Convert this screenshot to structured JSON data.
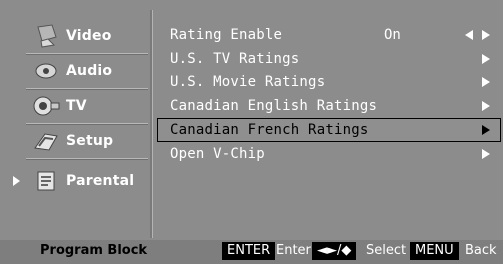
{
  "sidebar": {
    "items": [
      {
        "label": "Video",
        "icon": "video-icon"
      },
      {
        "label": "Audio",
        "icon": "audio-icon"
      },
      {
        "label": "TV",
        "icon": "tv-icon"
      },
      {
        "label": "Setup",
        "icon": "setup-icon"
      },
      {
        "label": "Parental",
        "icon": "parental-icon",
        "active": true
      }
    ]
  },
  "content": {
    "rows": [
      {
        "label": "Rating Enable",
        "value": "On"
      },
      {
        "label": "U.S. TV Ratings"
      },
      {
        "label": "U.S. Movie Ratings"
      },
      {
        "label": "Canadian English Ratings"
      },
      {
        "label": "Canadian French Ratings",
        "selected": true
      },
      {
        "label": "Open V-Chip"
      }
    ]
  },
  "footer": {
    "title": "Program Block",
    "enter_key": "ENTER",
    "enter_label": "Enter",
    "select_key": "◄►/◆",
    "select_label": "Select",
    "menu_key": "MENU",
    "menu_label": "Back"
  }
}
